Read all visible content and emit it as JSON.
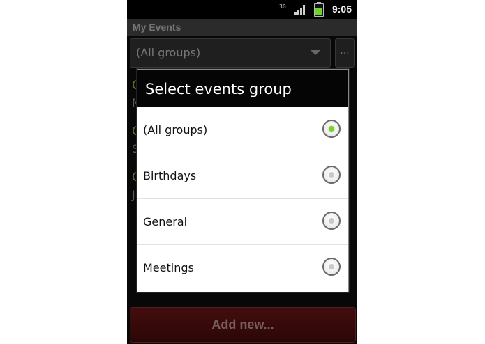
{
  "status_bar": {
    "network": "3G",
    "time": "9:05"
  },
  "app": {
    "title": "My Events"
  },
  "filter": {
    "selected": "(All groups)",
    "more_label": "..."
  },
  "background_list": [
    {
      "line1": "C",
      "line2": "M"
    },
    {
      "line1": "C",
      "line2": "S"
    },
    {
      "line1": "C",
      "line2": "J"
    }
  ],
  "dialog": {
    "title": "Select events group",
    "options": [
      {
        "label": "(All groups)",
        "selected": true
      },
      {
        "label": "Birthdays",
        "selected": false
      },
      {
        "label": "General",
        "selected": false
      },
      {
        "label": "Meetings",
        "selected": false
      }
    ]
  },
  "footer": {
    "add_label": "Add new..."
  },
  "colors": {
    "accent": "#7ed02f",
    "add_button": "#5a1212",
    "dialog_header": "#050505"
  }
}
